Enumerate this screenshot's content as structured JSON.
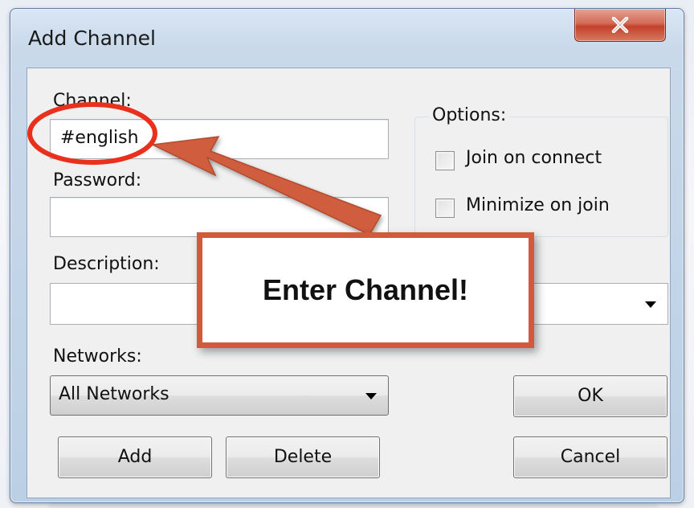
{
  "window": {
    "title": "Add Channel",
    "close_icon": "close-icon"
  },
  "channel": {
    "label": "Channel:",
    "value": "#english"
  },
  "password": {
    "label": "Password:",
    "value": ""
  },
  "description": {
    "label": "Description:",
    "value": ""
  },
  "options": {
    "label": "Options:",
    "join_on_connect": {
      "label": "Join on connect",
      "checked": false
    },
    "minimize_on_join": {
      "label": "Minimize on join",
      "checked": false
    }
  },
  "networks": {
    "label": "Networks:",
    "selected": "All Networks"
  },
  "buttons": {
    "ok": "OK",
    "add": "Add",
    "delete": "Delete",
    "cancel": "Cancel"
  },
  "annotation": {
    "callout_text": "Enter Channel!",
    "color": "#d05a3a"
  }
}
